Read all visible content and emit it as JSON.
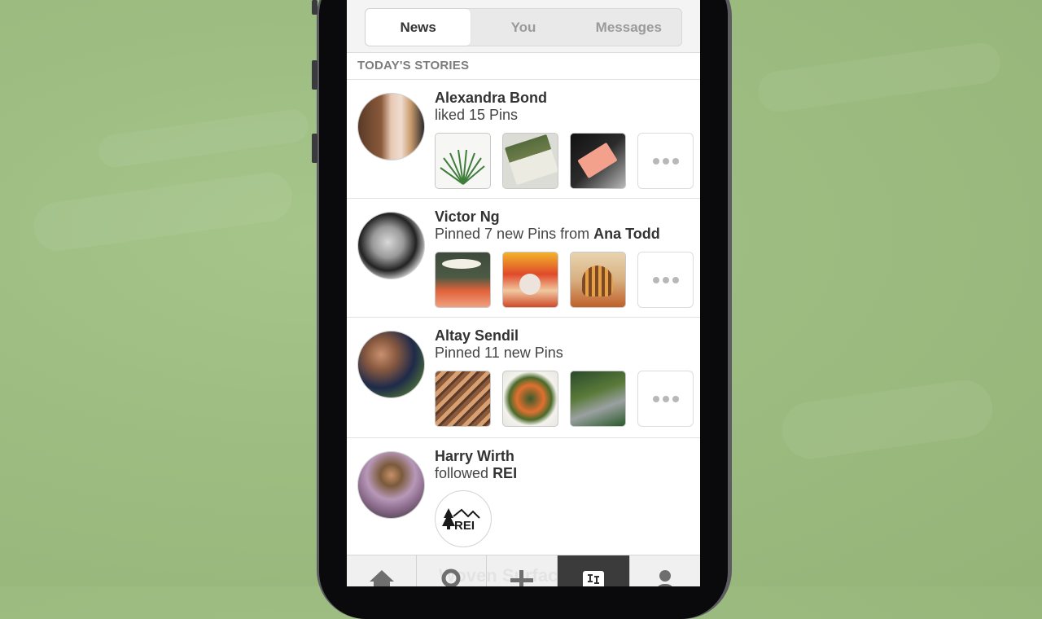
{
  "colors": {
    "background": "#9dbd82",
    "active_tab_bg": "#3b3b3b",
    "text_primary": "#333333",
    "text_muted": "#9a9a9a"
  },
  "segmented_control": {
    "tabs": [
      {
        "label": "News",
        "active": true
      },
      {
        "label": "You",
        "active": false
      },
      {
        "label": "Messages",
        "active": false
      }
    ]
  },
  "section_header": "TODAY'S STORIES",
  "stories": [
    {
      "name": "Alexandra Bond",
      "action_prefix": "liked 15 Pins",
      "action_bold": "",
      "thumbs": [
        "palm-leaf-pin",
        "book-pin",
        "pink-box-pin"
      ],
      "more_icon": "ellipsis-icon"
    },
    {
      "name": "Victor Ng",
      "action_prefix": "Pinned 7 new Pins from",
      "action_bold": "Ana Todd",
      "thumbs": [
        "hat-woman-illustration-pin",
        "girl-poster-pin",
        "bob-haircut-poster-pin"
      ],
      "more_icon": "ellipsis-icon"
    },
    {
      "name": "Altay Sendil",
      "action_prefix": "Pinned 11 new Pins",
      "action_bold": "",
      "thumbs": [
        "sandstone-waves-pin",
        "vegetable-dish-pin",
        "garden-path-pin"
      ],
      "more_icon": "ellipsis-icon"
    },
    {
      "name": "Harry Wirth",
      "action_prefix": "followed",
      "action_bold": "REI",
      "brand_logo": "REI"
    }
  ],
  "tab_bar": {
    "items": [
      {
        "icon": "home-icon",
        "active": false
      },
      {
        "icon": "search-icon",
        "active": false
      },
      {
        "icon": "plus-icon",
        "active": false
      },
      {
        "icon": "pin-news-icon",
        "active": true
      },
      {
        "icon": "profile-icon",
        "active": false
      }
    ],
    "ghost_text": "Woven Surface"
  }
}
